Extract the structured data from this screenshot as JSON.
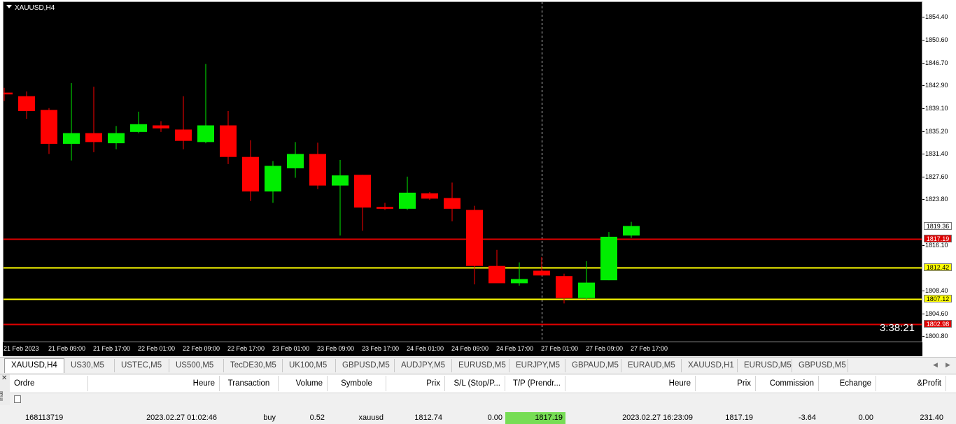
{
  "chart": {
    "title": "XAUUSD,H4",
    "countdown": "3:38:21",
    "price_axis": [
      "1854.40",
      "1850.60",
      "1846.70",
      "1842.90",
      "1839.10",
      "1835.20",
      "1831.40",
      "1827.60",
      "1823.80",
      "1816.10",
      "1808.40",
      "1804.60",
      "1800.80"
    ],
    "price_tags": [
      {
        "label": "1819.36",
        "bg": "#ffffff",
        "fg": "#000000"
      },
      {
        "label": "1817.19",
        "bg": "#e00000",
        "fg": "#ffffff"
      },
      {
        "label": "1812.42",
        "bg": "#ffff00",
        "fg": "#000000"
      },
      {
        "label": "1807.12",
        "bg": "#ffff00",
        "fg": "#000000"
      },
      {
        "label": "1802.98",
        "bg": "#e00000",
        "fg": "#ffffff"
      }
    ],
    "time_axis": [
      "21 Feb 2023",
      "21 Feb 09:00",
      "21 Feb 17:00",
      "22 Feb 01:00",
      "22 Feb 09:00",
      "22 Feb 17:00",
      "23 Feb 01:00",
      "23 Feb 09:00",
      "23 Feb 17:00",
      "24 Feb 01:00",
      "24 Feb 09:00",
      "24 Feb 17:00",
      "27 Feb 01:00",
      "27 Feb 09:00",
      "27 Feb 17:00"
    ],
    "colors": {
      "bull": "#00ee00",
      "bear": "#ff0000",
      "background": "#000000",
      "tp_line": "#e00000",
      "sl_line": "#e00000",
      "level_line": "#ffff00"
    }
  },
  "chart_data": {
    "type": "candlestick",
    "symbol": "XAUUSD",
    "timeframe": "H4",
    "ylim": [
      1800.0,
      1857.0
    ],
    "candles": [
      {
        "o": 1841.8,
        "h": 1842.6,
        "l": 1840.4,
        "c": 1841.5
      },
      {
        "o": 1841.2,
        "h": 1842.0,
        "l": 1837.4,
        "c": 1838.7
      },
      {
        "o": 1838.9,
        "h": 1839.2,
        "l": 1831.5,
        "c": 1833.2
      },
      {
        "o": 1833.2,
        "h": 1843.4,
        "l": 1830.4,
        "c": 1835.0
      },
      {
        "o": 1835.0,
        "h": 1842.8,
        "l": 1831.8,
        "c": 1833.5
      },
      {
        "o": 1833.3,
        "h": 1836.2,
        "l": 1832.3,
        "c": 1835.0
      },
      {
        "o": 1835.2,
        "h": 1838.6,
        "l": 1835.0,
        "c": 1836.5
      },
      {
        "o": 1836.3,
        "h": 1837.0,
        "l": 1835.2,
        "c": 1835.8
      },
      {
        "o": 1835.6,
        "h": 1841.2,
        "l": 1832.3,
        "c": 1833.7
      },
      {
        "o": 1833.5,
        "h": 1846.6,
        "l": 1833.3,
        "c": 1836.3
      },
      {
        "o": 1836.3,
        "h": 1838.7,
        "l": 1829.8,
        "c": 1831.0
      },
      {
        "o": 1831.0,
        "h": 1833.8,
        "l": 1823.6,
        "c": 1825.2
      },
      {
        "o": 1825.2,
        "h": 1830.3,
        "l": 1823.3,
        "c": 1829.5
      },
      {
        "o": 1829.1,
        "h": 1833.5,
        "l": 1827.5,
        "c": 1831.5
      },
      {
        "o": 1831.5,
        "h": 1833.4,
        "l": 1825.6,
        "c": 1826.2
      },
      {
        "o": 1826.2,
        "h": 1830.5,
        "l": 1817.8,
        "c": 1827.9
      },
      {
        "o": 1828.0,
        "h": 1828.0,
        "l": 1818.6,
        "c": 1822.5
      },
      {
        "o": 1822.6,
        "h": 1823.3,
        "l": 1822.1,
        "c": 1822.3
      },
      {
        "o": 1822.3,
        "h": 1827.7,
        "l": 1822.1,
        "c": 1825.0
      },
      {
        "o": 1824.9,
        "h": 1825.1,
        "l": 1823.8,
        "c": 1824.0
      },
      {
        "o": 1824.1,
        "h": 1826.7,
        "l": 1820.2,
        "c": 1822.3
      },
      {
        "o": 1822.1,
        "h": 1822.8,
        "l": 1809.6,
        "c": 1812.7
      },
      {
        "o": 1812.7,
        "h": 1815.4,
        "l": 1809.9,
        "c": 1809.8
      },
      {
        "o": 1809.8,
        "h": 1813.3,
        "l": 1809.4,
        "c": 1810.5
      },
      {
        "o": 1811.9,
        "h": 1814.2,
        "l": 1811.1,
        "c": 1811.1
      },
      {
        "o": 1811.0,
        "h": 1811.4,
        "l": 1806.4,
        "c": 1807.3
      },
      {
        "o": 1807.3,
        "h": 1813.5,
        "l": 1807.0,
        "c": 1809.9
      },
      {
        "o": 1810.3,
        "h": 1818.4,
        "l": 1810.3,
        "c": 1817.6
      },
      {
        "o": 1817.8,
        "h": 1820.1,
        "l": 1817.4,
        "c": 1819.4
      }
    ],
    "horizontal_lines": [
      {
        "price": 1817.19,
        "color": "red"
      },
      {
        "price": 1812.42,
        "color": "yellow"
      },
      {
        "price": 1807.12,
        "color": "yellow"
      },
      {
        "price": 1802.98,
        "color": "red"
      }
    ],
    "grid": false
  },
  "tabs": [
    {
      "label": "XAUUSD,H4",
      "active": true
    },
    {
      "label": "US30,M5"
    },
    {
      "label": "USTEC,M5"
    },
    {
      "label": "US500,M5"
    },
    {
      "label": "TecDE30,M5"
    },
    {
      "label": "UK100,M5"
    },
    {
      "label": "GBPUSD,M5"
    },
    {
      "label": "AUDJPY,M5"
    },
    {
      "label": "EURUSD,M5"
    },
    {
      "label": "EURJPY,M5"
    },
    {
      "label": "GBPAUD,M5"
    },
    {
      "label": "EURAUD,M5"
    },
    {
      "label": "XAUUSD,H1"
    },
    {
      "label": "EURUSD,M5"
    },
    {
      "label": "GBPUSD,M5"
    }
  ],
  "terminal": {
    "side_label": "inal",
    "close_glyph": "✕",
    "columns": [
      "Ordre",
      "Heure",
      "Transaction",
      "Volume",
      "Symbole",
      "Prix",
      "S/L (Stop/P...",
      "T/P (Prendr...",
      "Heure",
      "Prix",
      "Commission",
      "Echange",
      "&Profit"
    ],
    "row": [
      "168113719",
      "2023.02.27 01:02:46",
      "buy",
      "0.52",
      "xauusd",
      "1812.74",
      "0.00",
      "1817.19",
      "2023.02.27 16:23:09",
      "1817.19",
      "-3.64",
      "0.00",
      "231.40"
    ],
    "tp_highlight": "#77dd55"
  }
}
